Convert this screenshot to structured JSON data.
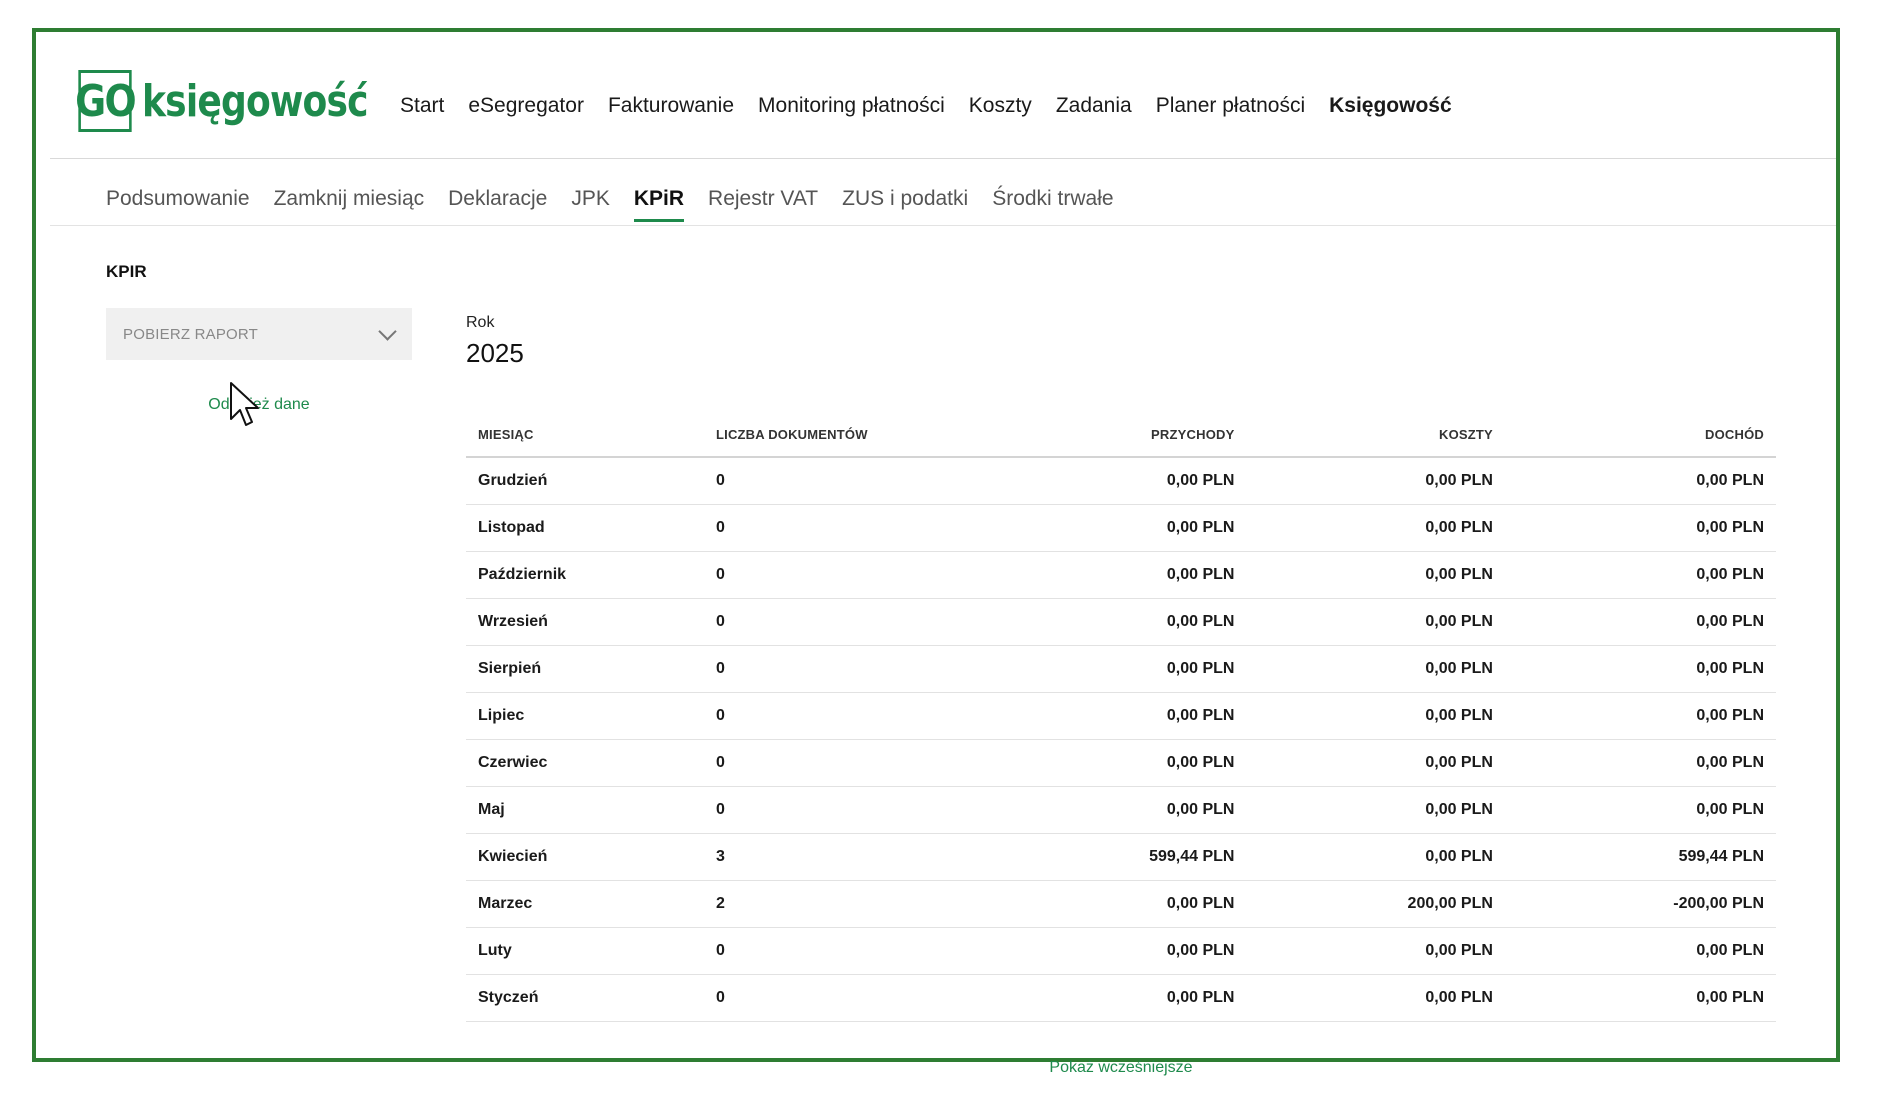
{
  "brand": {
    "logo_mark": "GO",
    "logo_text": "księgowość",
    "accent_color": "#1e8a4c",
    "frame_color": "#2e7d32"
  },
  "main_nav": [
    {
      "label": "Start",
      "active": false
    },
    {
      "label": "eSegregator",
      "active": false
    },
    {
      "label": "Fakturowanie",
      "active": false
    },
    {
      "label": "Monitoring płatności",
      "active": false
    },
    {
      "label": "Koszty",
      "active": false
    },
    {
      "label": "Zadania",
      "active": false
    },
    {
      "label": "Planer płatności",
      "active": false
    },
    {
      "label": "Księgowość",
      "active": true
    }
  ],
  "sub_nav": [
    {
      "label": "Podsumowanie",
      "active": false
    },
    {
      "label": "Zamknij miesiąc",
      "active": false
    },
    {
      "label": "Deklaracje",
      "active": false
    },
    {
      "label": "JPK",
      "active": false
    },
    {
      "label": "KPiR",
      "active": true
    },
    {
      "label": "Rejestr VAT",
      "active": false
    },
    {
      "label": "ZUS i podatki",
      "active": false
    },
    {
      "label": "Środki trwałe",
      "active": false
    }
  ],
  "page": {
    "title": "KPIR",
    "report_select": {
      "label": "POBIERZ RAPORT",
      "icon": "chevron-down-icon"
    },
    "refresh_link": "Odśwież dane",
    "year_label": "Rok",
    "year_value": "2025",
    "show_more": "Pokaż wcześniejsze"
  },
  "table": {
    "headers": [
      "MIESIĄC",
      "LICZBA DOKUMENTÓW",
      "PRZYCHODY",
      "KOSZTY",
      "DOCHÓD"
    ],
    "rows": [
      [
        "Grudzień",
        "0",
        "0,00 PLN",
        "0,00 PLN",
        "0,00 PLN"
      ],
      [
        "Listopad",
        "0",
        "0,00 PLN",
        "0,00 PLN",
        "0,00 PLN"
      ],
      [
        "Październik",
        "0",
        "0,00 PLN",
        "0,00 PLN",
        "0,00 PLN"
      ],
      [
        "Wrzesień",
        "0",
        "0,00 PLN",
        "0,00 PLN",
        "0,00 PLN"
      ],
      [
        "Sierpień",
        "0",
        "0,00 PLN",
        "0,00 PLN",
        "0,00 PLN"
      ],
      [
        "Lipiec",
        "0",
        "0,00 PLN",
        "0,00 PLN",
        "0,00 PLN"
      ],
      [
        "Czerwiec",
        "0",
        "0,00 PLN",
        "0,00 PLN",
        "0,00 PLN"
      ],
      [
        "Maj",
        "0",
        "0,00 PLN",
        "0,00 PLN",
        "0,00 PLN"
      ],
      [
        "Kwiecień",
        "3",
        "599,44 PLN",
        "0,00 PLN",
        "599,44 PLN"
      ],
      [
        "Marzec",
        "2",
        "0,00 PLN",
        "200,00 PLN",
        "-200,00 PLN"
      ],
      [
        "Luty",
        "0",
        "0,00 PLN",
        "0,00 PLN",
        "0,00 PLN"
      ],
      [
        "Styczeń",
        "0",
        "0,00 PLN",
        "0,00 PLN",
        "0,00 PLN"
      ]
    ]
  }
}
